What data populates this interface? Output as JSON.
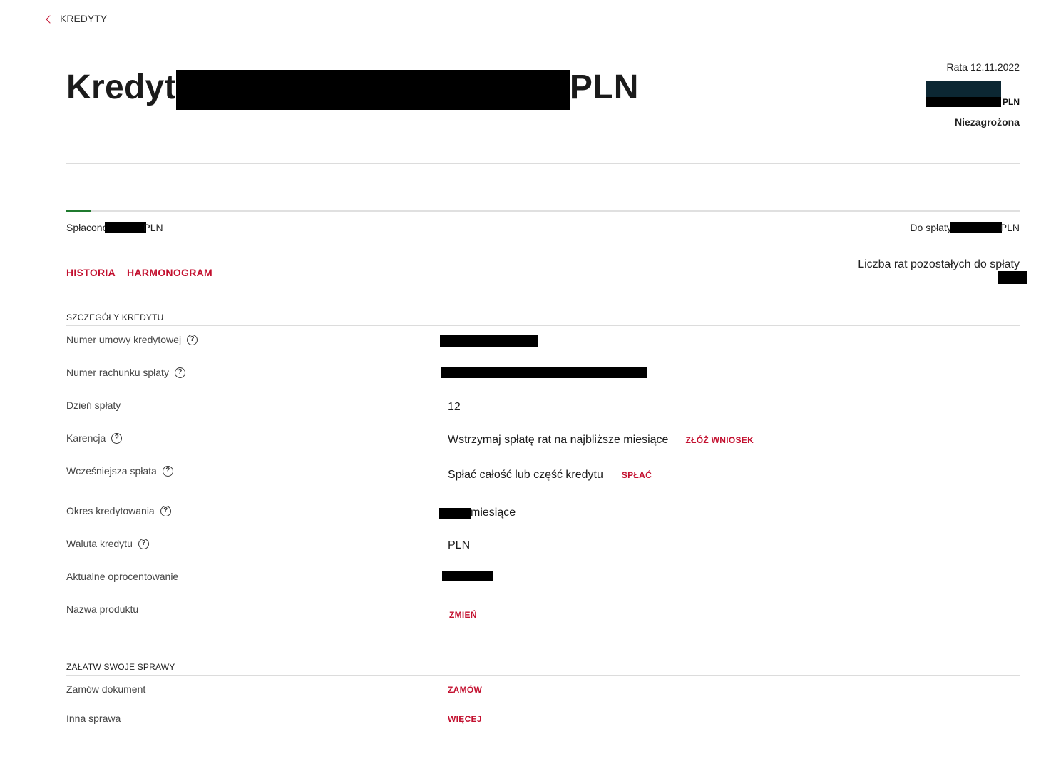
{
  "nav": {
    "back_label": "KREDYTY"
  },
  "header": {
    "title_prefix": "Kredyt",
    "title_suffix": "PLN",
    "rata_label": "Rata 12.11.2022",
    "rata_currency": "PLN",
    "status": "Niezagrożona"
  },
  "progress": {
    "paid_label": "Spłacono",
    "paid_currency": "PLN",
    "due_label": "Do spłaty",
    "due_currency": "PLN"
  },
  "tabs": [
    {
      "label": "HISTORIA"
    },
    {
      "label": "HARMONOGRAM"
    }
  ],
  "remaining_installments_label": "Liczba rat pozostałych do spłaty",
  "details": {
    "section_title": "SZCZEGÓŁY KREDYTU",
    "rows": [
      {
        "label": "Numer umowy kredytowej"
      },
      {
        "label": "Numer rachunku spłaty"
      },
      {
        "label": "Dzień spłaty",
        "value": "12"
      },
      {
        "label": "Karencja",
        "value": "Wstrzymaj spłatę rat na najbliższe miesiące",
        "action": "ZŁÓŻ WNIOSEK"
      },
      {
        "label": "Wcześniejsza spłata",
        "value": "Spłać całość lub część kredytu",
        "action": "SPŁAĆ"
      },
      {
        "label": "Okres kredytowania",
        "value": "miesiące"
      },
      {
        "label": "Waluta kredytu",
        "value": "PLN"
      },
      {
        "label": "Aktualne oprocentowanie"
      },
      {
        "label": "Nazwa produktu",
        "action": "ZMIEŃ"
      }
    ]
  },
  "affairs": {
    "section_title": "ZAŁATW SWOJE SPRAWY",
    "rows": [
      {
        "label": "Zamów dokument",
        "action": "ZAMÓW"
      },
      {
        "label": "Inna sprawa",
        "action": "WIĘCEJ"
      }
    ]
  },
  "colors": {
    "accent": "#c3102f",
    "progress": "#1f7a2e"
  },
  "icons": {
    "back": "chevron-left-icon",
    "help": "question-circle-icon"
  }
}
